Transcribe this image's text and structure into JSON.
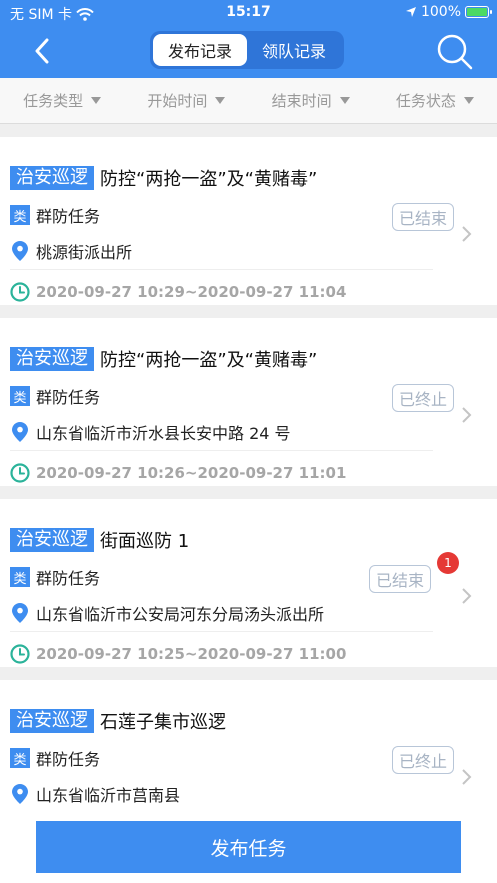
{
  "status_bar": {
    "carrier": "无 SIM 卡",
    "time": "15:17",
    "battery": "100%"
  },
  "header": {
    "tabs": [
      "发布记录",
      "领队记录"
    ]
  },
  "filters": [
    "任务类型",
    "开始时间",
    "结束时间",
    "任务状态"
  ],
  "cards": [
    {
      "category": "治安巡逻",
      "title": "防控“两抢一盗”及“黄赌毒”",
      "type_badge": "类",
      "type": "群防任务",
      "location": "桃源街派出所",
      "time": "2020-09-27 10:29~2020-09-27 11:04",
      "status": "已结束"
    },
    {
      "category": "治安巡逻",
      "title": "防控“两抢一盗”及“黄赌毒”",
      "type_badge": "类",
      "type": "群防任务",
      "location": "山东省临沂市沂水县长安中路 24 号",
      "time": "2020-09-27 10:26~2020-09-27 11:01",
      "status": "已终止"
    },
    {
      "category": "治安巡逻",
      "title": "街面巡防 1",
      "type_badge": "类",
      "type": "群防任务",
      "location": "山东省临沂市公安局河东分局汤头派出所",
      "time": "2020-09-27 10:25~2020-09-27 11:00",
      "status": "已结束",
      "count": "1"
    },
    {
      "category": "治安巡逻",
      "title": "石莲子集市巡逻",
      "type_badge": "类",
      "type": "群防任务",
      "location": "山东省临沂市莒南县",
      "time": "",
      "status": "已终止"
    }
  ],
  "publish_button": "发布任务"
}
